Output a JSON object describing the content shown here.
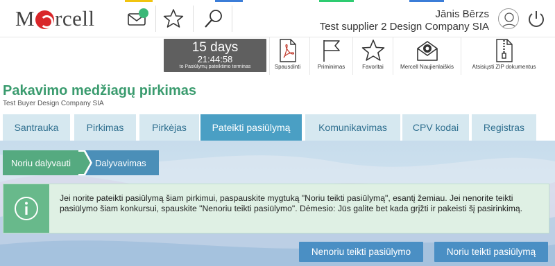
{
  "header": {
    "logo_text_before": "M",
    "logo_text_after": "rcell",
    "user_name": "Jānis Bērzs",
    "company": "Test supplier 2 Design Company SIA",
    "colors": {
      "mail_dot": "#3cb878",
      "logo_accent": "#d9262a"
    }
  },
  "deadline": {
    "days": "15 days",
    "time": "21:44:58",
    "label": "to Pasiūlymų pateiktimo terminas"
  },
  "actions": [
    {
      "icon": "pdf-icon",
      "label": "Spausdinti"
    },
    {
      "icon": "flag-icon",
      "label": "Priminimas"
    },
    {
      "icon": "star-icon",
      "label": "Favoritai"
    },
    {
      "icon": "newsletter-icon",
      "label": "Mercell Naujienlaiškis"
    },
    {
      "icon": "zip-icon",
      "label": "Atsisiųsti ZIP dokumentus"
    }
  ],
  "page": {
    "title": "Pakavimo medžiagų pirkimas",
    "subtitle": "Test Buyer Design Company SIA"
  },
  "tabs": [
    {
      "label": "Santrauka",
      "active": false
    },
    {
      "label": "Pirkimas",
      "active": false
    },
    {
      "label": "Pirkėjas",
      "active": false
    },
    {
      "label": "Pateikti pasiūlymą",
      "active": true
    },
    {
      "label": "Komunikavimas",
      "active": false
    },
    {
      "label": "CPV kodai",
      "active": false
    },
    {
      "label": "Registras",
      "active": false
    }
  ],
  "steps": [
    {
      "label": "Noriu dalyvauti"
    },
    {
      "label": "Dalyvavimas"
    }
  ],
  "info": {
    "text": "Jei norite pateikti pasiūlymą šiam pirkimui, paspauskite mygtuką \"Noriu teikti pasiūlymą\", esantį žemiau. Jei nenorite teikti pasiūlymo šiam konkursui, spauskite \"Nenoriu teikti pasiūlymo\". Dėmesio: Jūs galite bet kada grįžti ir pakeisti šį pasirinkimą."
  },
  "buttons": {
    "decline": "Nenoriu teikti pasiūlymo",
    "accept": "Noriu teikti pasiūlymą"
  }
}
